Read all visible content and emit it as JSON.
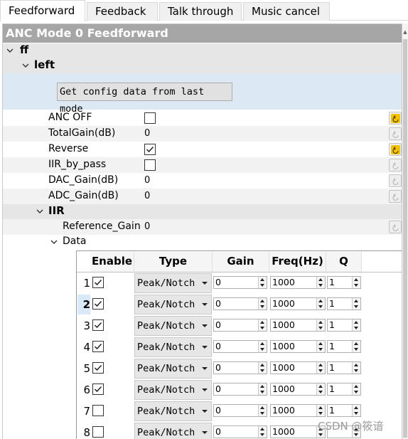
{
  "tabs": [
    {
      "label": "Feedforward",
      "active": true
    },
    {
      "label": "Feedback",
      "active": false
    },
    {
      "label": "Talk through",
      "active": false
    },
    {
      "label": "Music cancel",
      "active": false
    }
  ],
  "panel": {
    "title": "ANC Mode 0 Feedforward",
    "tree": {
      "root": "ff",
      "left": "left",
      "get_button": "Get config data from last mode",
      "properties": [
        {
          "label": "ANC OFF",
          "kind": "checkbox",
          "checked": false,
          "revert_active": true
        },
        {
          "label": "TotalGain(dB)",
          "kind": "value",
          "value": "0",
          "revert_active": false
        },
        {
          "label": "Reverse",
          "kind": "checkbox",
          "checked": true,
          "revert_active": true
        },
        {
          "label": "IIR_by_pass",
          "kind": "checkbox",
          "checked": false,
          "revert_active": false
        },
        {
          "label": "DAC_Gain(dB)",
          "kind": "value",
          "value": "0",
          "revert_active": false
        },
        {
          "label": "ADC_Gain(dB)",
          "kind": "value",
          "value": "0",
          "revert_active": false
        }
      ],
      "iir": "IIR",
      "reference_gain": {
        "label": "Reference_Gain",
        "value": "0"
      },
      "data": "Data"
    }
  },
  "table": {
    "headers": [
      "Enable",
      "Type",
      "Gain",
      "Freq(Hz)",
      "Q"
    ],
    "selected_row": 2,
    "rows": [
      {
        "n": "1",
        "enabled": true,
        "type": "Peak/Notch",
        "gain": "0",
        "freq": "1000",
        "q": "1"
      },
      {
        "n": "2",
        "enabled": true,
        "type": "Peak/Notch",
        "gain": "0",
        "freq": "1000",
        "q": "1"
      },
      {
        "n": "3",
        "enabled": true,
        "type": "Peak/Notch",
        "gain": "0",
        "freq": "1000",
        "q": "1"
      },
      {
        "n": "4",
        "enabled": true,
        "type": "Peak/Notch",
        "gain": "0",
        "freq": "1000",
        "q": "1"
      },
      {
        "n": "5",
        "enabled": true,
        "type": "Peak/Notch",
        "gain": "0",
        "freq": "1000",
        "q": "1"
      },
      {
        "n": "6",
        "enabled": true,
        "type": "Peak/Notch",
        "gain": "0",
        "freq": "1000",
        "q": "1"
      },
      {
        "n": "7",
        "enabled": false,
        "type": "Peak/Notch",
        "gain": "0",
        "freq": "1000",
        "q": "1"
      },
      {
        "n": "8",
        "enabled": false,
        "type": "Peak/Notch",
        "gain": "0",
        "freq": "1000",
        "q": ""
      }
    ]
  },
  "watermark": "CSDN @筱谙",
  "colors": {
    "title_bar": "#a6a6a6",
    "group_row": "#e6e6e6",
    "button_area": "#dce9f5",
    "revert_active": "#f2c200"
  }
}
